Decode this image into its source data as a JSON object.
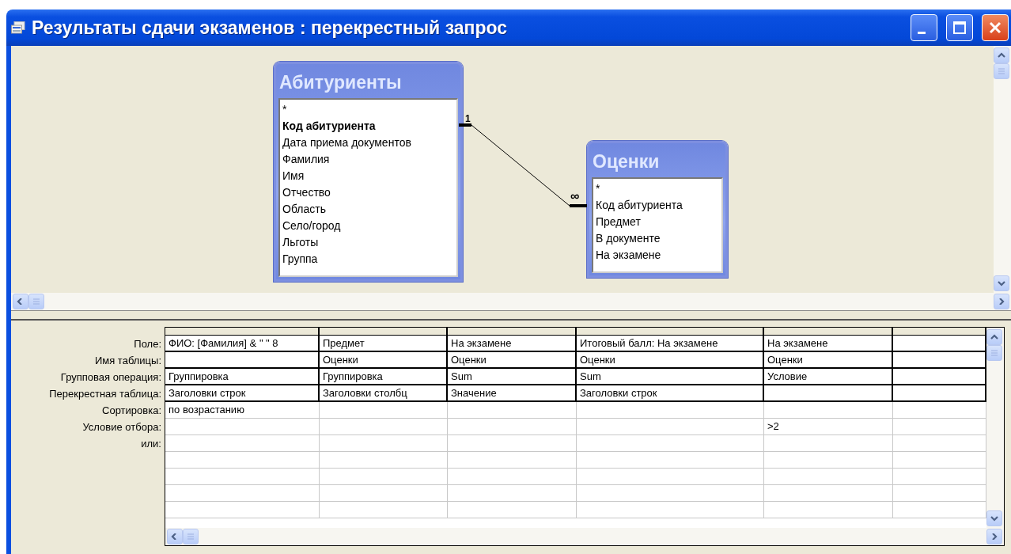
{
  "window": {
    "title": "Результаты сдачи экзаменов : перекрестный запрос"
  },
  "tables": [
    {
      "title": "Абитуриенты",
      "fields": [
        {
          "name": "*",
          "primary_key": false
        },
        {
          "name": "Код абитуриента",
          "primary_key": true
        },
        {
          "name": "Дата приема документов",
          "primary_key": false
        },
        {
          "name": "Фамилия",
          "primary_key": false
        },
        {
          "name": "Имя",
          "primary_key": false
        },
        {
          "name": "Отчество",
          "primary_key": false
        },
        {
          "name": "Область",
          "primary_key": false
        },
        {
          "name": "Село/город",
          "primary_key": false
        },
        {
          "name": "Льготы",
          "primary_key": false
        },
        {
          "name": "Группа",
          "primary_key": false
        }
      ]
    },
    {
      "title": "Оценки",
      "fields": [
        {
          "name": "*",
          "primary_key": false
        },
        {
          "name": "Код абитуриента",
          "primary_key": false
        },
        {
          "name": "Предмет",
          "primary_key": false
        },
        {
          "name": "В документе",
          "primary_key": false
        },
        {
          "name": "На экзамене",
          "primary_key": false
        }
      ]
    }
  ],
  "relationship": {
    "one_label": "1",
    "many_label": "∞"
  },
  "grid": {
    "rows": [
      {
        "label": "Поле:",
        "cells": [
          "ФИО: [Фамилия] & \" \" 8",
          "Предмет",
          "На экзамене",
          "Итоговый балл: На экзамене",
          "На экзамене",
          null
        ]
      },
      {
        "label": "Имя таблицы:",
        "cells": [
          null,
          "Оценки",
          "Оценки",
          "Оценки",
          "Оценки",
          null
        ]
      },
      {
        "label": "Групповая операция:",
        "cells": [
          "Группировка",
          "Группировка",
          "Sum",
          "Sum",
          "Условие",
          null
        ]
      },
      {
        "label": "Перекрестная таблица:",
        "cells": [
          "Заголовки строк",
          "Заголовки столбц",
          "Значение",
          "Заголовки строк",
          null,
          null
        ]
      },
      {
        "label": "Сортировка:",
        "cells": [
          "по возрастанию",
          null,
          null,
          null,
          null,
          null
        ]
      },
      {
        "label": "Условие отбора:",
        "cells": [
          null,
          null,
          null,
          null,
          ">2",
          null
        ]
      },
      {
        "label": "или:",
        "cells": [
          null,
          null,
          null,
          null,
          null,
          null
        ]
      }
    ]
  }
}
